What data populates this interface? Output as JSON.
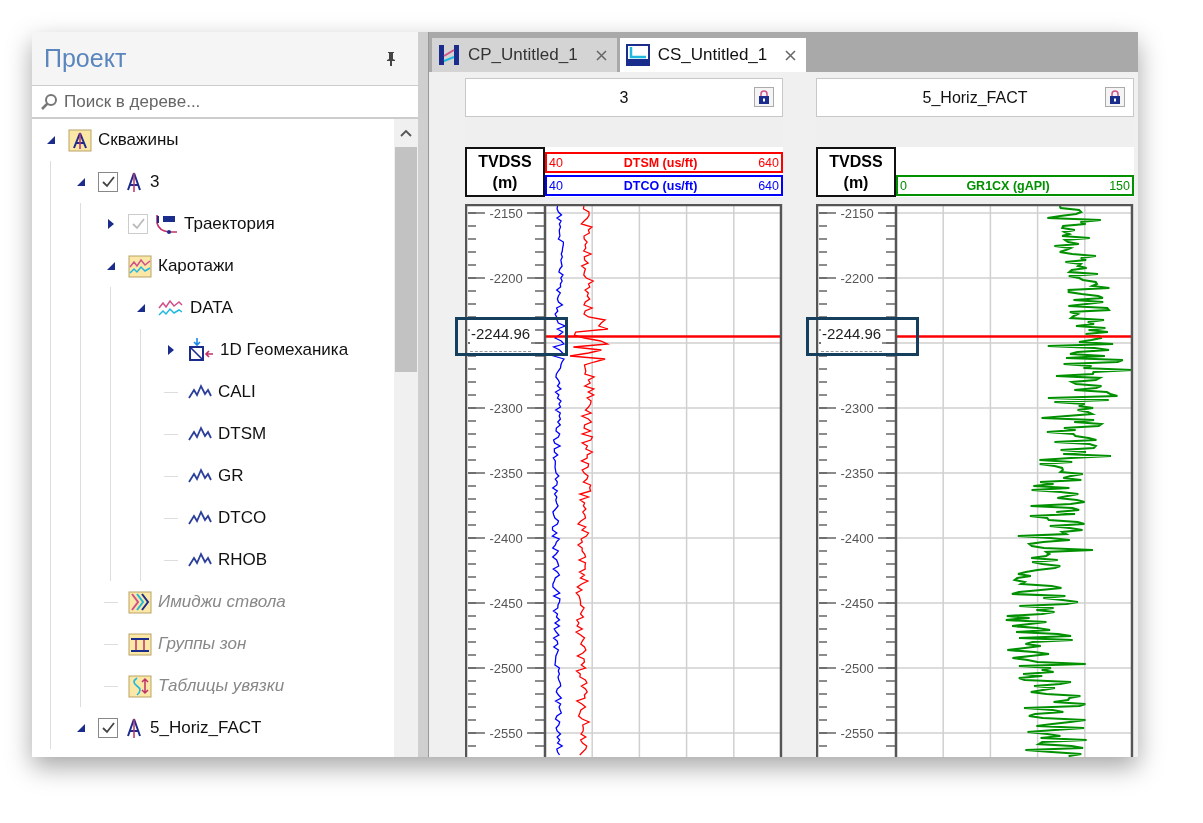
{
  "sidebar": {
    "title": "Проект",
    "search": {
      "placeholder": "Поиск в дереве..."
    },
    "tree": [
      {
        "label": "Скважины",
        "kind": "wells-folder",
        "dimmed": false,
        "expanded": true,
        "children": [
          {
            "label": "3",
            "kind": "well",
            "dimmed": false,
            "checked": true,
            "expanded": true,
            "children": [
              {
                "label": "Траектория",
                "kind": "trajectory",
                "dimmed": false,
                "checked": true,
                "check_disabled": true,
                "expanded": false
              },
              {
                "label": "Каротажи",
                "kind": "logs-folder",
                "dimmed": false,
                "expanded": true,
                "children": [
                  {
                    "label": "DATA",
                    "kind": "log-set",
                    "dimmed": false,
                    "expanded": true,
                    "children": [
                      {
                        "label": "1D Геомеханика",
                        "kind": "geomechanics",
                        "dimmed": false,
                        "expanded": false
                      },
                      {
                        "label": "CALI",
                        "kind": "log",
                        "dimmed": false
                      },
                      {
                        "label": "DTSM",
                        "kind": "log",
                        "dimmed": false
                      },
                      {
                        "label": "GR",
                        "kind": "log",
                        "dimmed": false
                      },
                      {
                        "label": "DTCO",
                        "kind": "log",
                        "dimmed": false
                      },
                      {
                        "label": "RHOB",
                        "kind": "log",
                        "dimmed": false
                      }
                    ]
                  }
                ]
              },
              {
                "label": "Имиджи ствола",
                "kind": "images-folder",
                "dimmed": true
              },
              {
                "label": "Группы зон",
                "kind": "zones-folder",
                "dimmed": true
              },
              {
                "label": "Таблицы увязки",
                "kind": "ties-folder",
                "dimmed": true
              }
            ]
          },
          {
            "label": "5_Horiz_FACT",
            "kind": "well",
            "dimmed": false,
            "checked": true,
            "expanded": true
          }
        ]
      }
    ]
  },
  "tabs": [
    {
      "label": "CP_Untitled_1",
      "kind": "cross-plot",
      "selected": false
    },
    {
      "label": "CS_Untitled_1",
      "kind": "cross-section",
      "selected": true
    }
  ],
  "panels": [
    {
      "title": "3",
      "axis_title": "TVDSS",
      "axis_unit": "(m)",
      "curves": [
        {
          "min": "40",
          "name": "DTSM (us/ft)",
          "max": "640",
          "color": "#ff0000",
          "kind": "shear-sonic"
        },
        {
          "min": "40",
          "name": "DTCO (us/ft)",
          "max": "640",
          "color": "#0000ff",
          "kind": "compressional-sonic"
        }
      ],
      "depth_ticks": [
        "-2150",
        "-2200",
        "-2300",
        "-2350",
        "-2400",
        "-2450",
        "-2500",
        "-2550"
      ],
      "cursor_depth": "-2244.96"
    },
    {
      "title": "5_Horiz_FACT",
      "axis_title": "TVDSS",
      "axis_unit": "(m)",
      "curves": [
        {
          "min": "0",
          "name": "GR1CX (gAPI)",
          "max": "150",
          "color": "#009000",
          "kind": "gamma-ray"
        }
      ],
      "depth_ticks": [
        "-2150",
        "-2200",
        "-2300",
        "-2350",
        "-2400",
        "-2450",
        "-2500",
        "-2550"
      ],
      "cursor_depth": "-2244.96"
    }
  ]
}
